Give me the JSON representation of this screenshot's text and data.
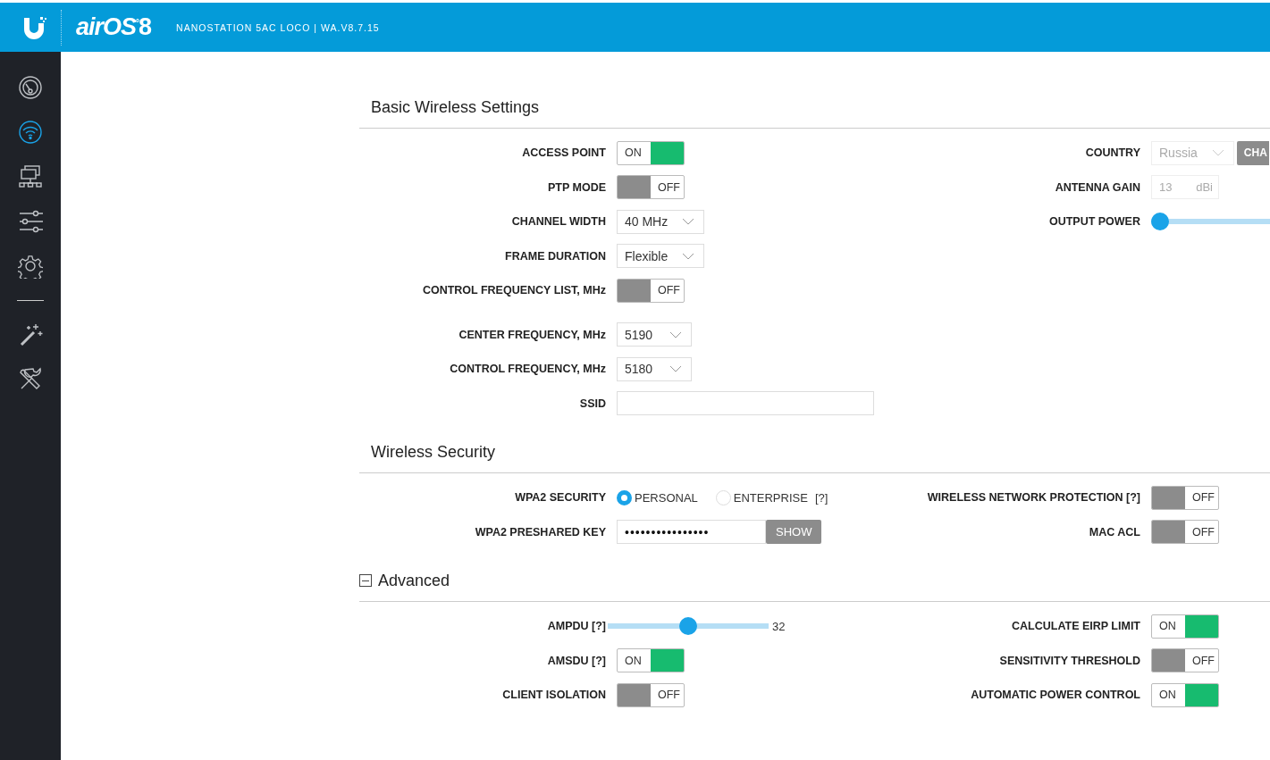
{
  "header": {
    "logo": "airOS",
    "logo_mark": "°",
    "logo_version": "8",
    "device": "NANOSTATION 5AC LOCO | WA.V8.7.15"
  },
  "sidebar": {
    "items": [
      {
        "selected": false
      },
      {
        "selected": true
      },
      {
        "selected": false
      },
      {
        "selected": false
      },
      {
        "selected": false
      },
      {
        "selected": false
      },
      {
        "selected": false
      }
    ]
  },
  "sections": [
    {
      "title": "Basic Wireless Settings",
      "left": [
        [
          {
            "kind": "toggle",
            "label": "ACCESS POINT",
            "on": true,
            "text": "ON"
          },
          {
            "kind": "toggle",
            "label": "PTP MODE",
            "on": false,
            "text": "OFF"
          },
          {
            "kind": "select",
            "label": "CHANNEL WIDTH",
            "value": "40 MHz"
          },
          {
            "kind": "select",
            "label": "FRAME DURATION",
            "value": "Flexible"
          },
          {
            "kind": "toggle",
            "label": "CONTROL FREQUENCY LIST, MHz",
            "on": false,
            "text": "OFF"
          }
        ],
        [
          {
            "kind": "select",
            "label": "CENTER FREQUENCY, MHz",
            "value": "5190"
          },
          {
            "kind": "select",
            "label": "CONTROL FREQUENCY, MHz",
            "value": "5180"
          },
          {
            "kind": "text",
            "label": "SSID"
          }
        ]
      ],
      "right": [
        {
          "kind": "select_button",
          "label": "COUNTRY",
          "value": "Russia",
          "disabled": true,
          "button": "CHA"
        },
        {
          "kind": "unit",
          "label": "ANTENNA GAIN",
          "value": "13",
          "unit": "dBi",
          "disabled": true
        },
        {
          "kind": "slider",
          "label": "OUTPUT POWER",
          "level": 0
        }
      ]
    },
    {
      "title": "Wireless Security",
      "left": [
        [
          {
            "kind": "radio",
            "label": "WPA2 SECURITY",
            "options": [
              {
                "label": "PERSONAL",
                "selected": true
              },
              {
                "label": "ENTERPRISE",
                "selected": false
              }
            ],
            "help": "[?]"
          },
          {
            "kind": "password",
            "label": "WPA2 PRESHARED KEY",
            "value": "••••••••••••••••",
            "button": "SHOW"
          }
        ]
      ],
      "right": [
        {
          "kind": "toggle",
          "label": "WIRELESS NETWORK PROTECTION [?]",
          "on": false,
          "text": "OFF"
        },
        {
          "kind": "toggle",
          "label": "MAC ACL",
          "on": false,
          "text": "OFF"
        }
      ]
    },
    {
      "title": "Advanced",
      "expanded": true,
      "left": [
        [
          {
            "kind": "slider",
            "label": "AMPDU [?]",
            "level": 0.5,
            "reading": "32"
          },
          {
            "kind": "toggle",
            "label": "AMSDU [?]",
            "on": true,
            "text": "ON"
          },
          {
            "kind": "toggle",
            "label": "CLIENT ISOLATION",
            "on": false,
            "text": "OFF"
          }
        ]
      ],
      "right": [
        {
          "kind": "toggle",
          "label": "CALCULATE EIRP LIMIT",
          "on": true,
          "text": "ON"
        },
        {
          "kind": "toggle",
          "label": "SENSITIVITY THRESHOLD",
          "on": false,
          "text": "OFF"
        },
        {
          "kind": "toggle",
          "label": "AUTOMATIC POWER CONTROL",
          "on": true,
          "text": "ON"
        }
      ]
    }
  ]
}
